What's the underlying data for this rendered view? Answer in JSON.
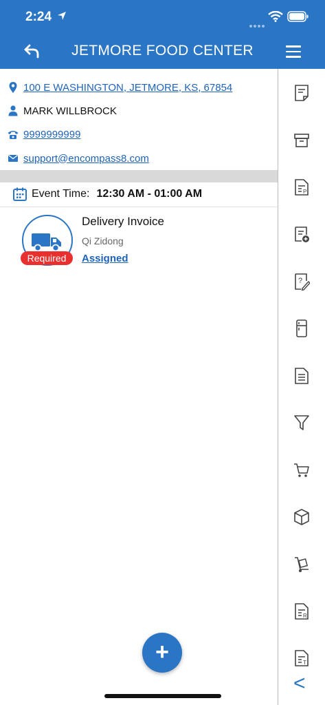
{
  "status_bar": {
    "time": "2:24"
  },
  "header": {
    "title": "JETMORE FOOD CENTER"
  },
  "info": {
    "address": "100 E WASHINGTON, JETMORE, KS, 67854",
    "contact": "MARK WILLBROCK",
    "phone": "9999999999",
    "email": "support@encompass8.com"
  },
  "event": {
    "label": "Event Time:",
    "value": "12:30 AM - 01:00 AM"
  },
  "task": {
    "title": "Delivery Invoice",
    "user": "Qi Zidong",
    "status": "Assigned",
    "badge": "Required"
  },
  "fab": {
    "label": "+"
  },
  "side_back": {
    "label": "<"
  },
  "colors": {
    "brand": "#2a75c4",
    "required": "#e8312f",
    "link": "#1f63b8"
  },
  "side_icons": [
    "note-icon",
    "archive-icon",
    "document-p-icon",
    "note-add-icon",
    "question-edit-icon",
    "fridge-icon",
    "document-lines-icon",
    "filter-icon",
    "cart-icon",
    "box-icon",
    "hand-truck-icon",
    "document-r-icon",
    "document-t-icon"
  ]
}
